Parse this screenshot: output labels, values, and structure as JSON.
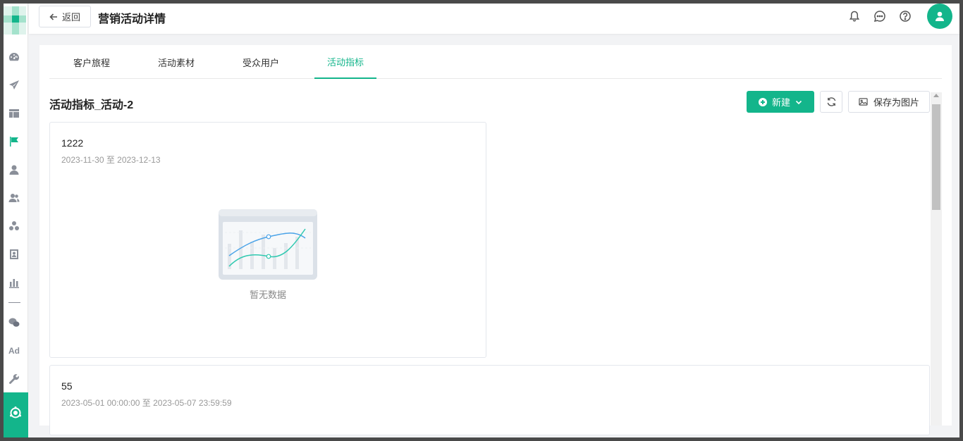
{
  "colors": {
    "accent": "#13b58b",
    "text": "#222222",
    "muted": "#999999"
  },
  "sidebar": {
    "items": [
      {
        "icon": "dashboard-icon"
      },
      {
        "icon": "send-icon"
      },
      {
        "icon": "layout-icon"
      },
      {
        "icon": "flag-icon",
        "active": true
      },
      {
        "icon": "user-icon"
      },
      {
        "icon": "users-icon"
      },
      {
        "icon": "cluster-icon"
      },
      {
        "icon": "profile-card-icon"
      },
      {
        "icon": "bar-chart-icon"
      },
      {
        "icon": "wechat-icon"
      },
      {
        "icon": "ad-icon",
        "label": "Ad"
      },
      {
        "icon": "wrench-icon"
      },
      {
        "icon": "marketing-hub-icon"
      }
    ]
  },
  "header": {
    "back_label": "返回",
    "title": "营销活动详情",
    "icons": [
      "bell-icon",
      "chat-icon",
      "help-icon",
      "avatar"
    ]
  },
  "tabs": [
    {
      "label": "客户旅程"
    },
    {
      "label": "活动素材"
    },
    {
      "label": "受众用户"
    },
    {
      "label": "活动指标",
      "active": true
    }
  ],
  "toolbar": {
    "section_title": "活动指标_活动-2",
    "new_label": "新建",
    "save_image_label": "保存为图片"
  },
  "cards": [
    {
      "name": "1222",
      "date_range": "2023-11-30 至 2023-12-13",
      "empty_text": "暂无数据"
    },
    {
      "name": "55",
      "date_range": "2023-05-01 00:00:00 至 2023-05-07 23:59:59"
    }
  ]
}
